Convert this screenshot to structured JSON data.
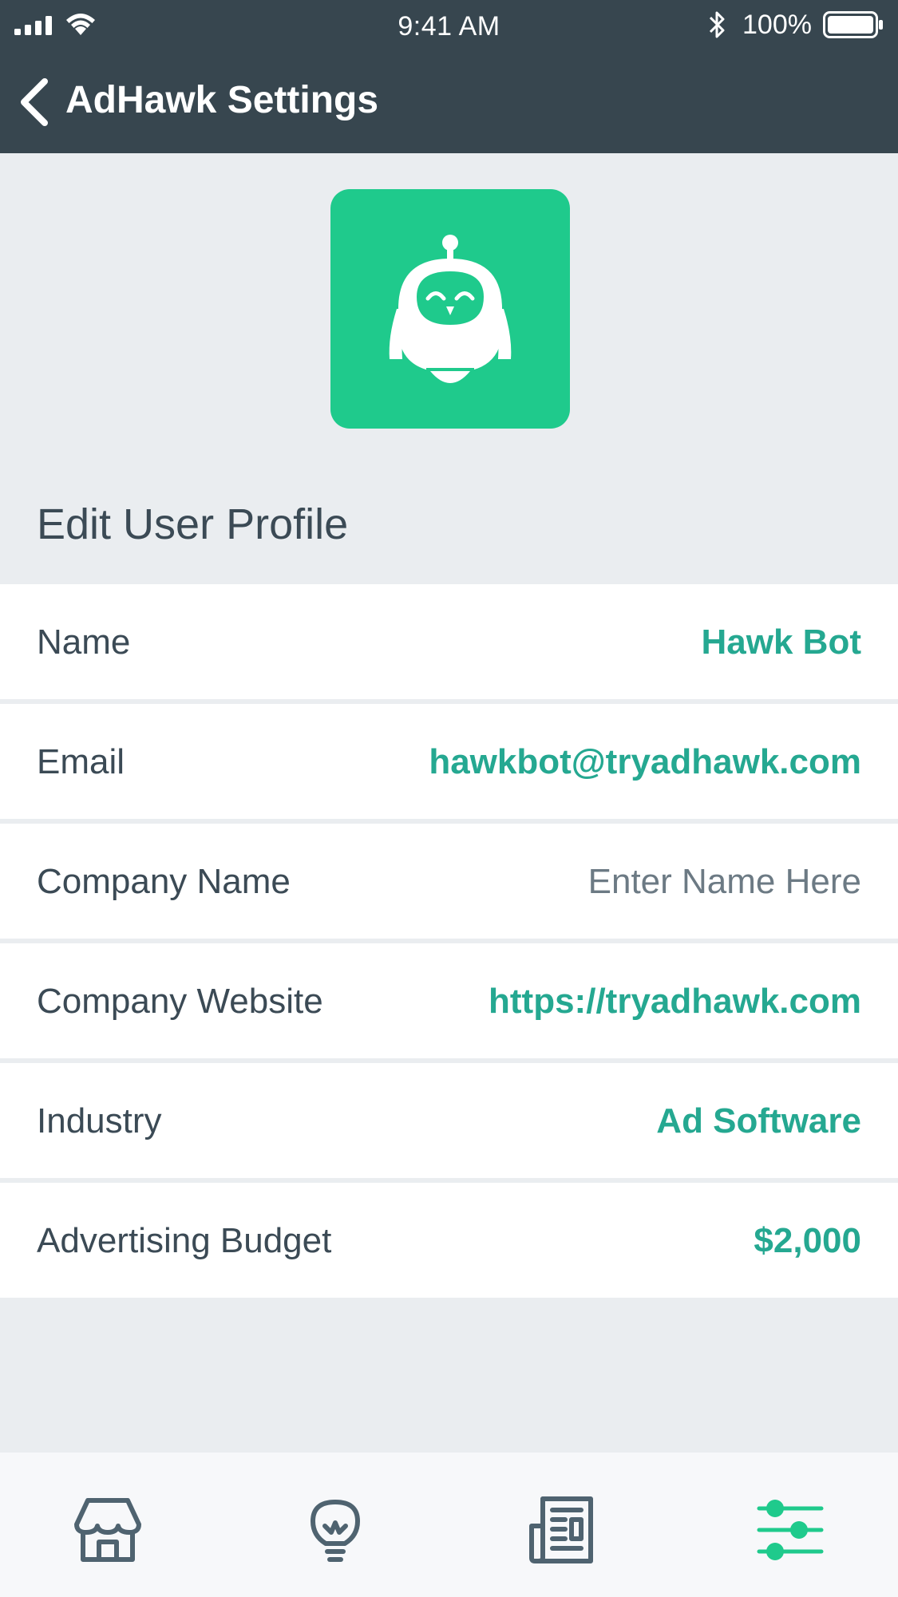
{
  "status_bar": {
    "time": "9:41 AM",
    "battery": "100%"
  },
  "nav": {
    "title": "AdHawk Settings"
  },
  "section": {
    "title": "Edit User Profile"
  },
  "profile_rows": [
    {
      "label": "Name",
      "value": "Hawk Bot"
    },
    {
      "label": "Email",
      "value": "hawkbot@tryadhawk.com"
    },
    {
      "label": "Company Name",
      "value": "Enter Name Here"
    },
    {
      "label": "Company Website",
      "value": "https://tryadhawk.com"
    },
    {
      "label": "Industry",
      "value": "Ad Software"
    },
    {
      "label": "Advertising Budget",
      "value": "$2,000"
    }
  ],
  "tabbar": {
    "items": [
      {
        "icon": "storefront-icon",
        "active": false
      },
      {
        "icon": "lightbulb-icon",
        "active": false
      },
      {
        "icon": "newspaper-icon",
        "active": false
      },
      {
        "icon": "sliders-icon",
        "active": true
      }
    ]
  },
  "colors": {
    "header_bg": "#37464f",
    "accent": "#25a891",
    "logo_bg": "#1fca8c",
    "page_bg": "#eaedf0",
    "icon_inactive": "#4f6370"
  }
}
